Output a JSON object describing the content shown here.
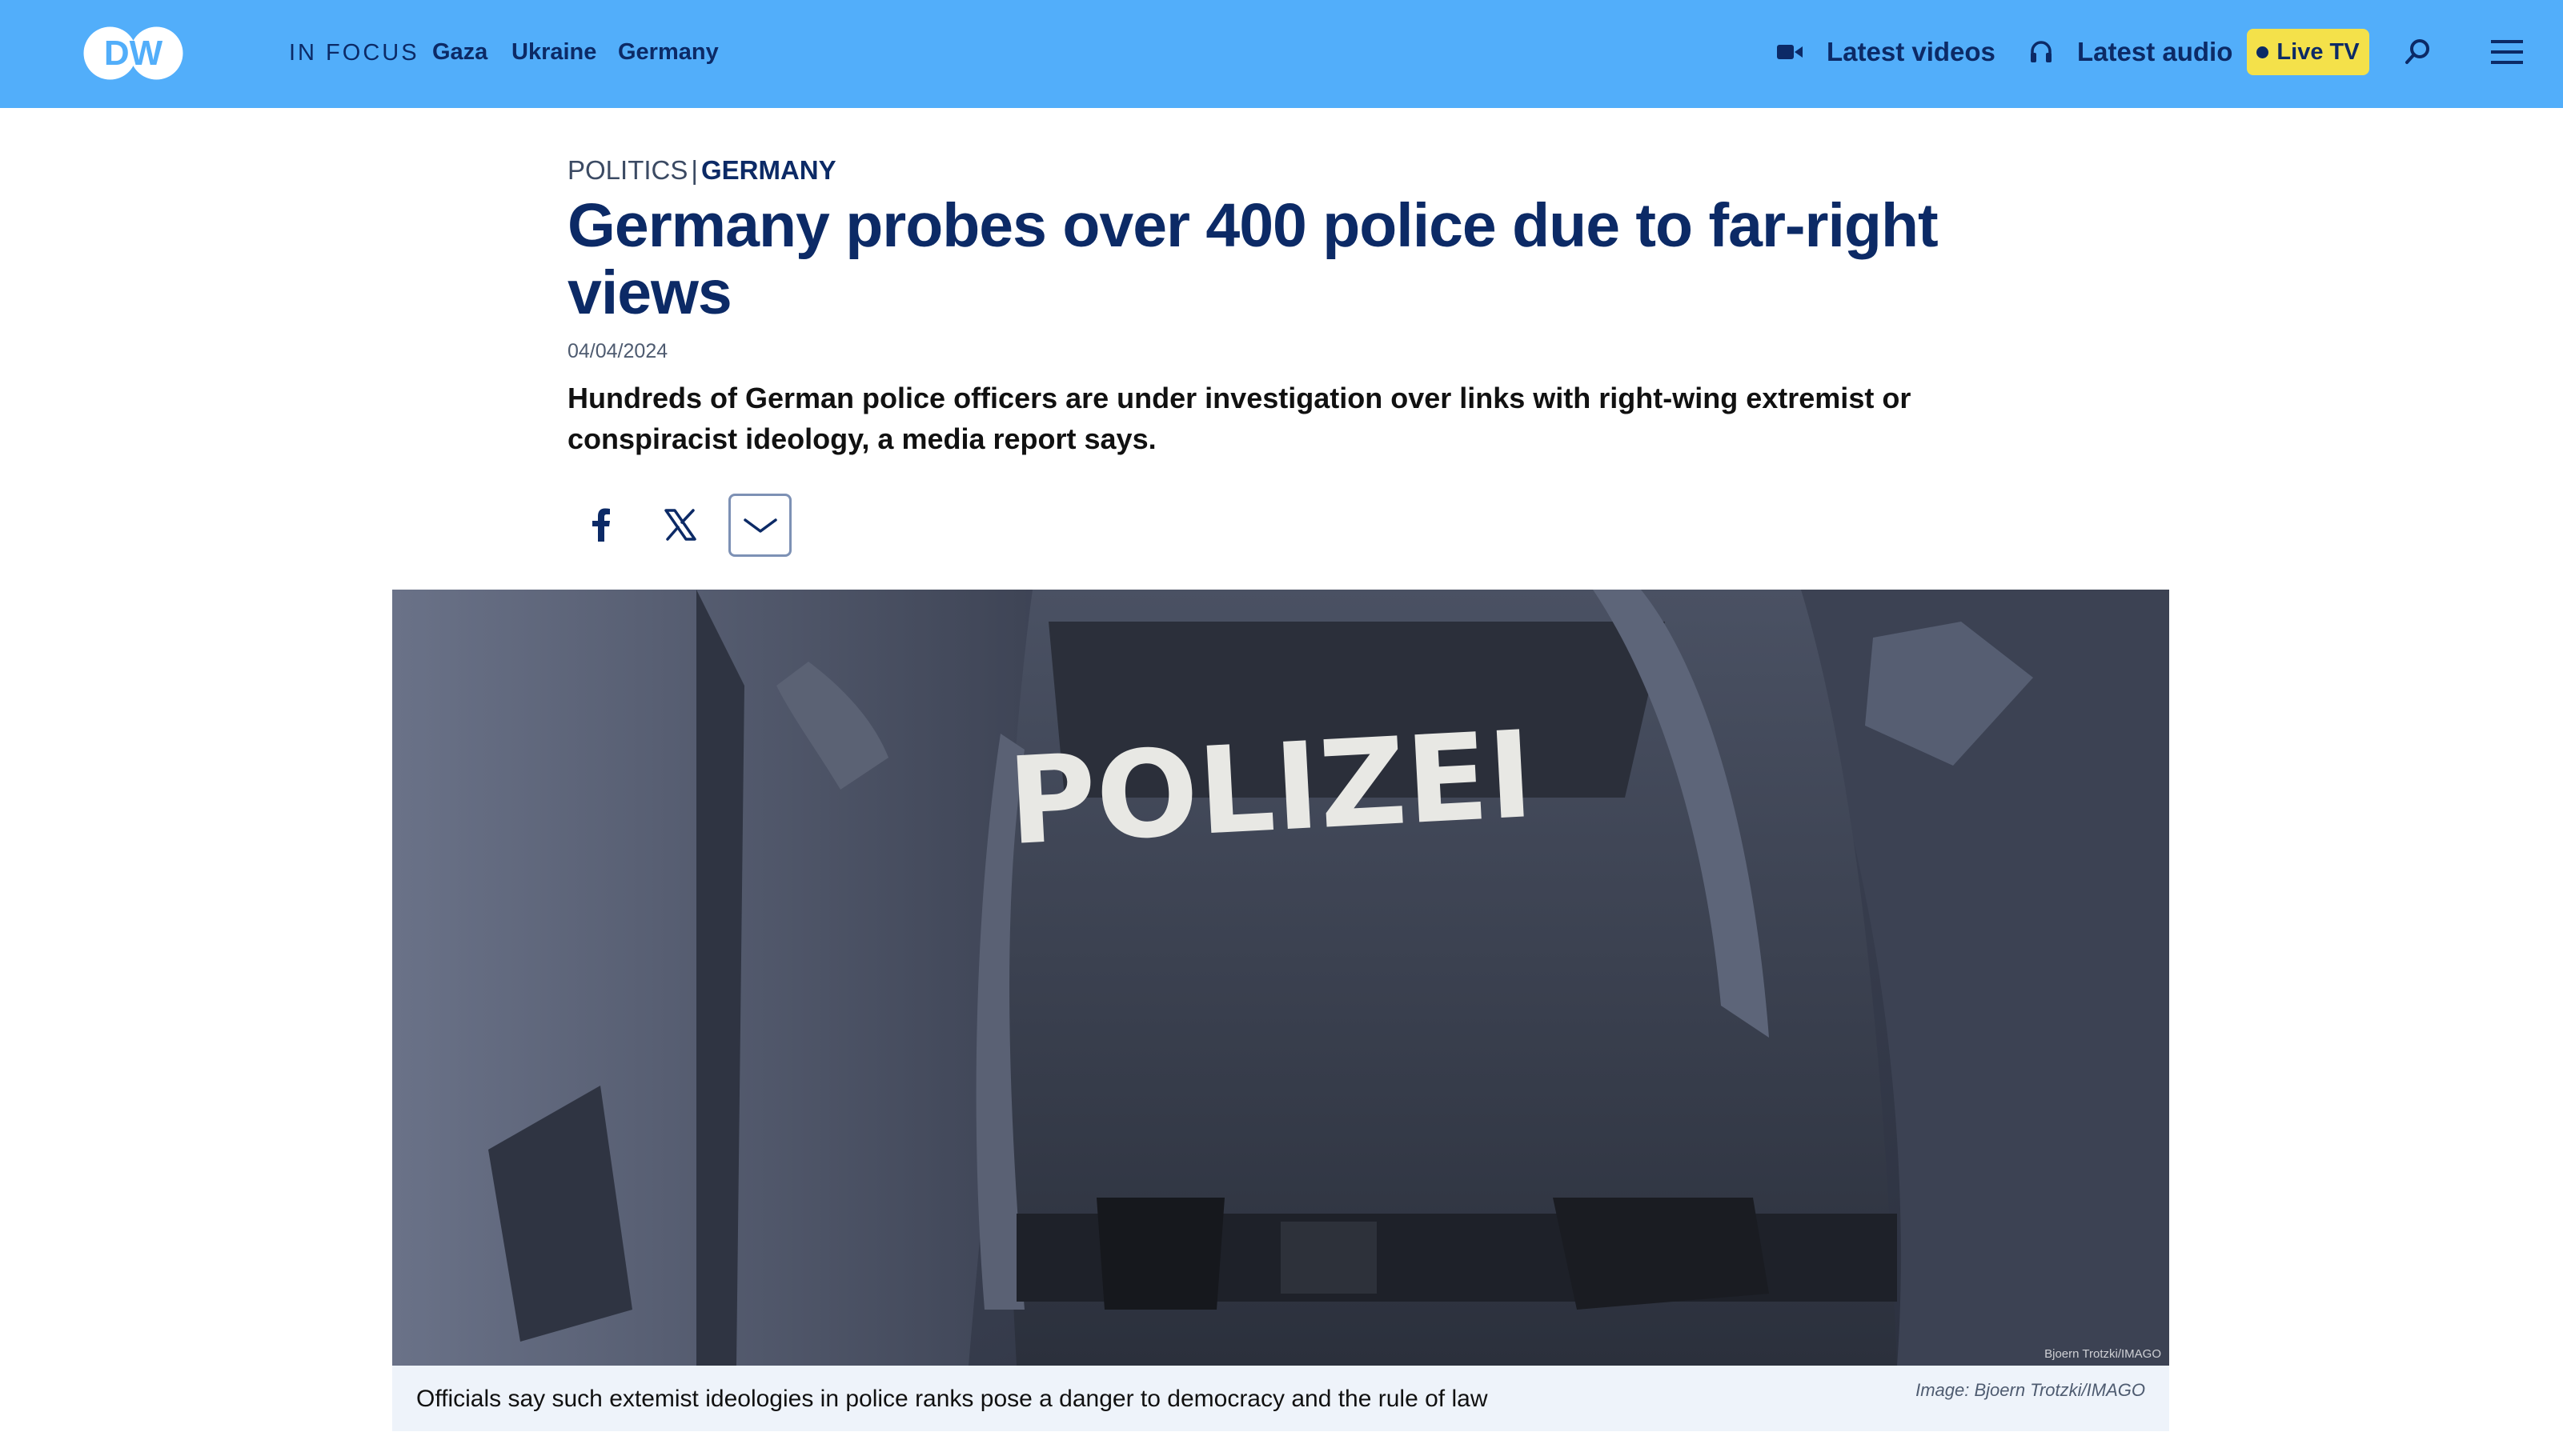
{
  "header": {
    "logo_text": "DW",
    "in_focus_label": "IN FOCUS",
    "focus_links": [
      "Gaza",
      "Ukraine",
      "Germany"
    ],
    "latest_videos": "Latest videos",
    "latest_audio": "Latest audio",
    "live_tv": "Live TV",
    "icons": {
      "videos": "video-camera-icon",
      "audio": "headphones-icon",
      "search": "search-icon",
      "menu": "hamburger-menu-icon"
    },
    "colors": {
      "background": "#52aefa",
      "text": "#0c2a66",
      "live_tv_bg": "#f4e14a"
    }
  },
  "article": {
    "kicker_section": "POLITICS",
    "kicker_separator": "|",
    "kicker_category": "GERMANY",
    "headline": "Germany probes over 400 police due to far-right views",
    "date": "04/04/2024",
    "teaser": "Hundreds of German police officers are under investigation over links with right-wing extremist or conspiracist ideology, a media report says.",
    "share": {
      "facebook": "facebook-icon",
      "x": "x-icon",
      "more": "chevron-down-icon"
    }
  },
  "hero": {
    "jacket_text": "POLIZEI",
    "watermark": "Bjoern Trotzki/IMAGO",
    "caption": "Officials say such extemist ideologies in police ranks pose a danger to democracy and the rule of law",
    "credit": "Image: Bjoern Trotzki/IMAGO"
  }
}
